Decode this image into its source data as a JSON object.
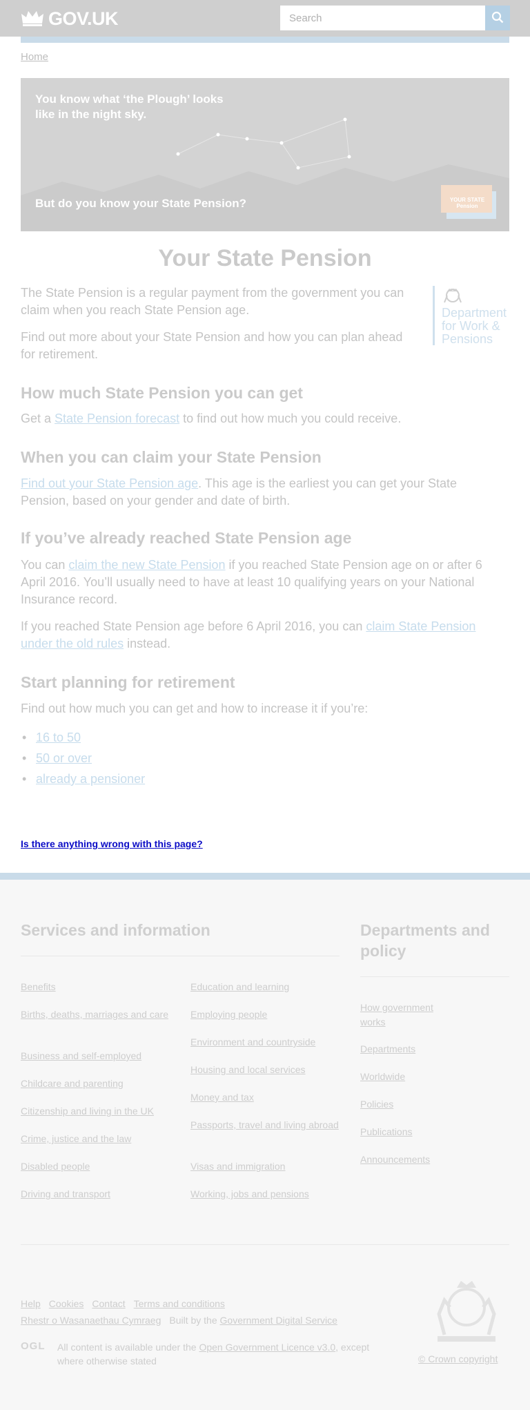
{
  "header": {
    "logo_text": "GOV.UK",
    "search_placeholder": "Search"
  },
  "breadcrumb": {
    "home": "Home"
  },
  "hero": {
    "line1": "You know what ‘the Plough’ looks like in the night sky.",
    "line2": "But do you know your State Pension?",
    "badge_text": "YOUR STATE Pension"
  },
  "page_title": "Your State Pension",
  "intro": {
    "p1": "The State Pension is a regular payment from the government you can claim when you reach State Pension age.",
    "p2": "Find out more about your State Pension and how you can plan ahead for retirement."
  },
  "department": {
    "name": "Department for Work & Pensions"
  },
  "sections": {
    "how_much": {
      "heading": "How much State Pension you can get",
      "pre": "Get a ",
      "link": "State Pension forecast",
      "post": " to find out how much you could receive."
    },
    "when": {
      "heading": "When you can claim your State Pension",
      "link": "Find out your State Pension age",
      "post": ". This age is the earliest you can get your State Pension, based on your gender and date of birth."
    },
    "reached": {
      "heading": "If you’ve already reached State Pension age",
      "p1_pre": "You can ",
      "p1_link": "claim the new State Pension",
      "p1_post": " if you reached State Pension age on or after 6 April 2016. You’ll usually need to have at least 10 qualifying years on your National Insurance record.",
      "p2_pre": "If you reached State Pension age before 6 April 2016, you can ",
      "p2_link": "claim State Pension under the old rules",
      "p2_post": " instead."
    },
    "planning": {
      "heading": "Start planning for retirement",
      "intro": "Find out how much you can get and how to increase it if you’re:",
      "items": [
        "16 to 50",
        "50 or over",
        "already a pensioner"
      ]
    }
  },
  "feedback": {
    "text": "Is there anything wrong with this page?"
  },
  "footer": {
    "services_heading": "Services and information",
    "services_col1": [
      "Benefits",
      "Births, deaths, marriages and care",
      "Business and self-employed",
      "Childcare and parenting",
      "Citizenship and living in the UK",
      "Crime, justice and the law",
      "Disabled people",
      "Driving and transport"
    ],
    "services_col2": [
      "Education and learning",
      "Employing people",
      "Environment and countryside",
      "Housing and local services",
      "Money and tax",
      "Passports, travel and living abroad",
      "Visas and immigration",
      "Working, jobs and pensions"
    ],
    "departments_heading": "Departments and policy",
    "departments": [
      "How government works",
      "Departments",
      "Worldwide",
      "Policies",
      "Publications",
      "Announcements"
    ],
    "meta": [
      "Help",
      "Cookies",
      "Contact",
      "Terms and conditions",
      "Rhestr o Wasanaethau Cymraeg"
    ],
    "built_by_pre": "Built by the ",
    "built_by_link": "Government Digital Service",
    "ogl": "OGL",
    "licence_pre": "All content is available under the ",
    "licence_link": "Open Government Licence v3.0",
    "licence_post": ", except where otherwise stated",
    "copyright": "© Crown copyright"
  }
}
